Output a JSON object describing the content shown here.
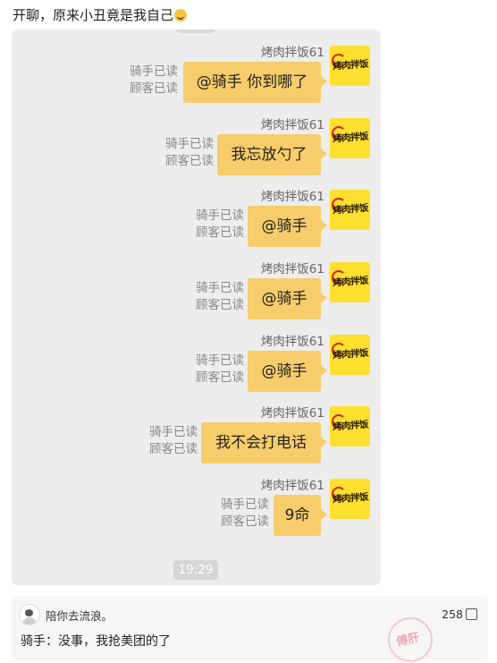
{
  "post": {
    "title": "开聊，原来小丑竟是我自己"
  },
  "chat": {
    "messages": [
      {
        "sender": "烤肉拌饭61",
        "text": "@骑手 你到哪了",
        "read_rider": "骑手已读",
        "read_customer": "顾客已读",
        "avatar_text": "烤肉拌饭"
      },
      {
        "sender": "烤肉拌饭61",
        "text": "我忘放勺了",
        "read_rider": "骑手已读",
        "read_customer": "顾客已读",
        "avatar_text": "烤肉拌饭"
      },
      {
        "sender": "烤肉拌饭61",
        "text": "@骑手",
        "read_rider": "骑手已读",
        "read_customer": "顾客已读",
        "avatar_text": "烤肉拌饭"
      },
      {
        "sender": "烤肉拌饭61",
        "text": "@骑手",
        "read_rider": "骑手已读",
        "read_customer": "顾客已读",
        "avatar_text": "烤肉拌饭"
      },
      {
        "sender": "烤肉拌饭61",
        "text": "@骑手",
        "read_rider": "骑手已读",
        "read_customer": "顾客已读",
        "avatar_text": "烤肉拌饭"
      },
      {
        "sender": "烤肉拌饭61",
        "text": "我不会打电话",
        "read_rider": "骑手已读",
        "read_customer": "顾客已读",
        "avatar_text": "烤肉拌饭"
      },
      {
        "sender": "烤肉拌饭61",
        "text": "9命",
        "read_rider": "骑手已读",
        "read_customer": "顾客已读",
        "avatar_text": "烤肉拌饭"
      }
    ],
    "time": "19:29"
  },
  "comment": {
    "username": "陪你去流浪。",
    "likes": "258",
    "text": "骑手：没事，我抢美团的了",
    "watermark": "傅肝"
  },
  "colors": {
    "bubble": "#f7cd6b",
    "avatar_bg": "#ffe02e",
    "chat_bg": "#ededed"
  },
  "icons": {
    "title_emoji": "grinning-face-icon",
    "like": "thumbs-up-icon",
    "avatar": "user-avatar-icon"
  }
}
